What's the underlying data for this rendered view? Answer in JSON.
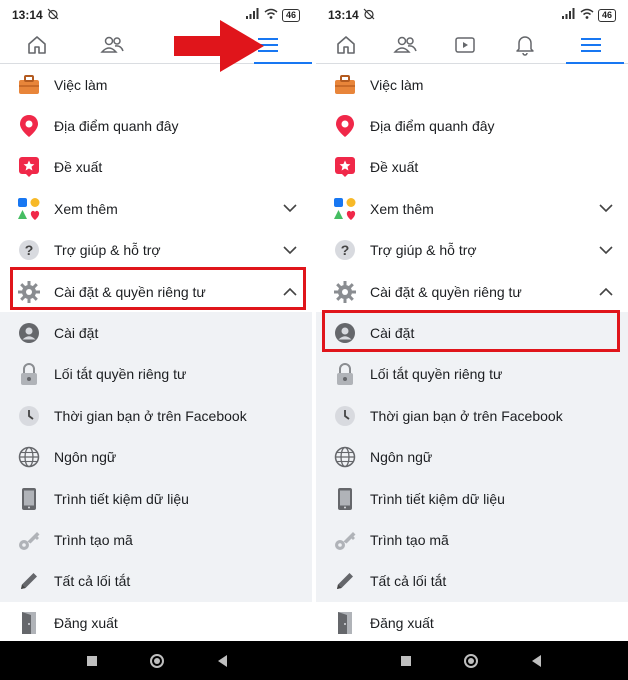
{
  "status_bar": {
    "time": "13:14",
    "battery": "46"
  },
  "colors": {
    "accent": "#1877f2",
    "highlight": "#e0151b",
    "submenu_bg": "#f0f2f5"
  },
  "nav": {
    "left_tabs": [
      "home-icon",
      "friends-icon",
      "watch-icon",
      "menu-icon"
    ],
    "right_tabs": [
      "home-icon",
      "friends-icon",
      "watch-icon",
      "notifications-icon",
      "menu-icon"
    ]
  },
  "menu": {
    "jobs": "Việc làm",
    "nearby": "Địa điểm quanh đây",
    "recommendations": "Đề xuất",
    "see_more": "Xem thêm",
    "help": "Trợ giúp & hỗ trợ",
    "settings_privacy": "Cài đặt & quyền riêng tư",
    "settings": "Cài đặt",
    "privacy_shortcuts": "Lối tắt quyền riêng tư",
    "your_time": "Thời gian bạn ở trên Facebook",
    "language": "Ngôn ngữ",
    "data_saver": "Trình tiết kiệm dữ liệu",
    "code_generator": "Trình tạo mã",
    "all_shortcuts": "Tất cả lối tắt",
    "logout": "Đăng xuất"
  }
}
